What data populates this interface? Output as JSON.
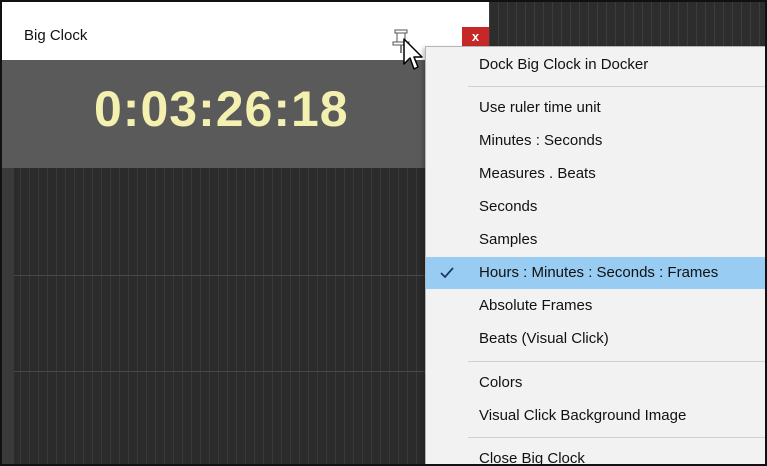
{
  "window": {
    "title": "Big Clock",
    "close_label": "x",
    "clock_time": "0:03:26:18"
  },
  "menu": {
    "items": [
      {
        "label": "Dock Big Clock in Docker",
        "checked": false
      },
      {
        "label": "Use ruler time unit",
        "checked": false
      },
      {
        "label": "Minutes : Seconds",
        "checked": false
      },
      {
        "label": "Measures . Beats",
        "checked": false
      },
      {
        "label": "Seconds",
        "checked": false
      },
      {
        "label": "Samples",
        "checked": false
      },
      {
        "label": "Hours : Minutes : Seconds : Frames",
        "checked": true
      },
      {
        "label": "Absolute Frames",
        "checked": false
      },
      {
        "label": "Beats (Visual Click)",
        "checked": false
      },
      {
        "label": "Colors",
        "checked": false
      },
      {
        "label": "Visual Click Background Image",
        "checked": false
      },
      {
        "label": "Close Big Clock",
        "checked": false
      }
    ]
  },
  "colors": {
    "clock_text": "#f3f0b0",
    "clock_background": "#5a5a5a",
    "selected_item": "#99ccf2",
    "close_button": "#c62828"
  },
  "icons": {
    "pin": "pin-icon",
    "check": "checkmark-icon",
    "cursor": "mouse-cursor-icon"
  }
}
